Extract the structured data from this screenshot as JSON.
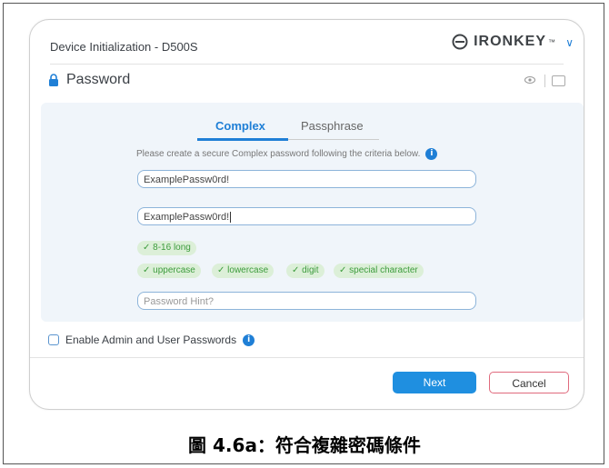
{
  "window": {
    "title": "Device Initialization - D500S",
    "brand": "IRONKEY",
    "brand_tm": "™"
  },
  "password": {
    "heading": "Password",
    "tabs": [
      "Complex",
      "Passphrase"
    ],
    "active_tab": "Complex",
    "instructions": "Please create a secure Complex password following the criteria below.",
    "password_value": "ExamplePassw0rd!",
    "confirm_value": "ExamplePassw0rd!",
    "hint_placeholder": "Password Hint?",
    "criteria": [
      "✓ 8-16 long",
      "✓ uppercase",
      "✓ lowercase",
      "✓ digit",
      "✓ special character"
    ]
  },
  "options": {
    "enable_admin_user": "Enable Admin and User Passwords"
  },
  "buttons": {
    "next": "Next",
    "cancel": "Cancel"
  },
  "caption": "圖 4.6a：符合複雜密碼條件",
  "colors": {
    "accent": "#1f7fd6",
    "panel": "#f0f5fa",
    "success": "#3d9c3d",
    "cancel_border": "#e06a7d"
  }
}
